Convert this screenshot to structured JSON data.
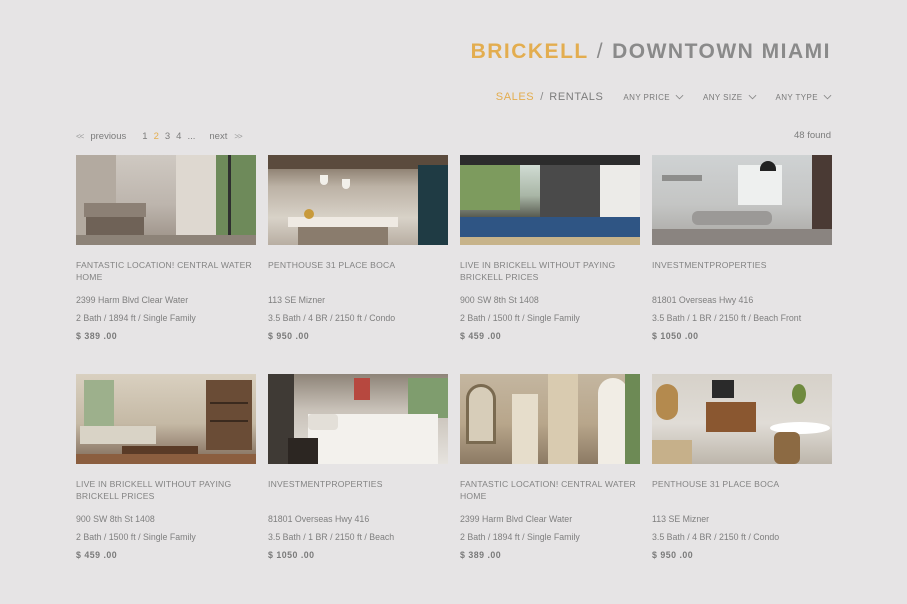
{
  "header": {
    "city_accent": "BRICKELL",
    "separator": "/",
    "city": "DOWNTOWN MIAMI",
    "accent_color": "#e3ad4f"
  },
  "filters": {
    "tabs": [
      {
        "label": "SALES",
        "active": true
      },
      {
        "label": "RENTALS",
        "active": false
      }
    ],
    "tab_separator": "/",
    "dropdowns": [
      {
        "label": "ANY PRICE",
        "icon": "chevron-down-icon"
      },
      {
        "label": "ANY SIZE",
        "icon": "chevron-down-icon"
      },
      {
        "label": "ANY TYPE",
        "icon": "chevron-down-icon"
      }
    ]
  },
  "pagination": {
    "prev_arrows": "<<",
    "prev_label": "previous",
    "pages": [
      "1",
      "2",
      "3",
      "4"
    ],
    "current_page": "2",
    "ellipsis": "...",
    "next_label": "next",
    "next_arrows": ">>",
    "found": "48 found"
  },
  "listings": [
    {
      "title": "FANTASTIC LOCATION! CENTRAL WATER   HOME",
      "address": "2399 Harm Blvd Clear Water",
      "details": "2 Bath  /  1894 ft  /  Single Family",
      "price": "$ 389 .00"
    },
    {
      "title": "PENTHOUSE 31 PLACE BOCA",
      "address": "113 SE Mizner",
      "details": "3.5 Bath  /  4 BR  /  2150 ft  /  Condo",
      "price": "$ 950 .00"
    },
    {
      "title": "LIVE IN BRICKELL WITHOUT PAYING BRICKELL PRICES",
      "address": "900 SW 8th St 1408",
      "details": "2 Bath  /  1500 ft  /  Single Family",
      "price": "$ 459 .00"
    },
    {
      "title": "INVESTMENTPROPERTIES",
      "address": "81801 Overseas Hwy 416",
      "details": "3.5 Bath  /  1 BR  /  2150 ft  /  Beach Front",
      "price": "$ 1050 .00"
    },
    {
      "title": "LIVE IN BRICKELL WITHOUT PAYING BRICKELL PRICES",
      "address": "900 SW 8th St 1408",
      "details": "2 Bath  /  1500 ft  /  Single Family",
      "price": "$ 459 .00"
    },
    {
      "title": "INVESTMENTPROPERTIES",
      "address": "81801 Overseas Hwy 416",
      "details": "3.5 Bath  /  1 BR  /  2150 ft  /  Beach",
      "price": "$ 1050 .00"
    },
    {
      "title": "FANTASTIC LOCATION! CENTRAL WATER   HOME",
      "address": "2399 Harm Blvd Clear Water",
      "details": "2 Bath  /  1894 ft  /  Single Family",
      "price": "$ 389 .00"
    },
    {
      "title": "PENTHOUSE 31 PLACE BOCA",
      "address": "113 SE Mizner",
      "details": "3.5 Bath  /  4 BR  /  2150 ft  /  Condo",
      "price": "$ 950 .00"
    }
  ]
}
